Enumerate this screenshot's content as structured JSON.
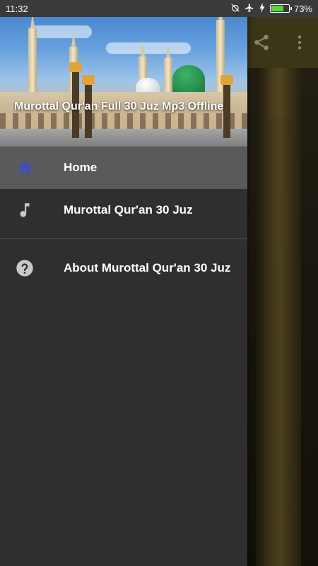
{
  "status_bar": {
    "time": "11:32",
    "battery_percent_text": "73%",
    "battery_level": 0.73,
    "icons": [
      "alarm-off-icon",
      "airplane-icon",
      "charging-bolt-icon",
      "battery-icon"
    ]
  },
  "background_app": {
    "toolbar_actions": [
      "share-icon",
      "more-vert-icon"
    ]
  },
  "drawer": {
    "header_title": "Murottal Qur'an Full 30 Juz Mp3 Offline",
    "items": [
      {
        "label": "Home",
        "icon": "home-icon",
        "active": true
      },
      {
        "label": "Murottal Qur'an 30 Juz",
        "icon": "music-note-icon",
        "active": false
      },
      {
        "label": "About Murottal Qur'an 30 Juz",
        "icon": "help-circle-icon",
        "active": false
      }
    ]
  },
  "colors": {
    "drawer_bg": "#2f2f2f",
    "active_item_bg": "#5a5a5a",
    "home_icon": "#3f51b5",
    "toolbar_bg": "#5d5426",
    "battery_fill": "#56d83a"
  }
}
